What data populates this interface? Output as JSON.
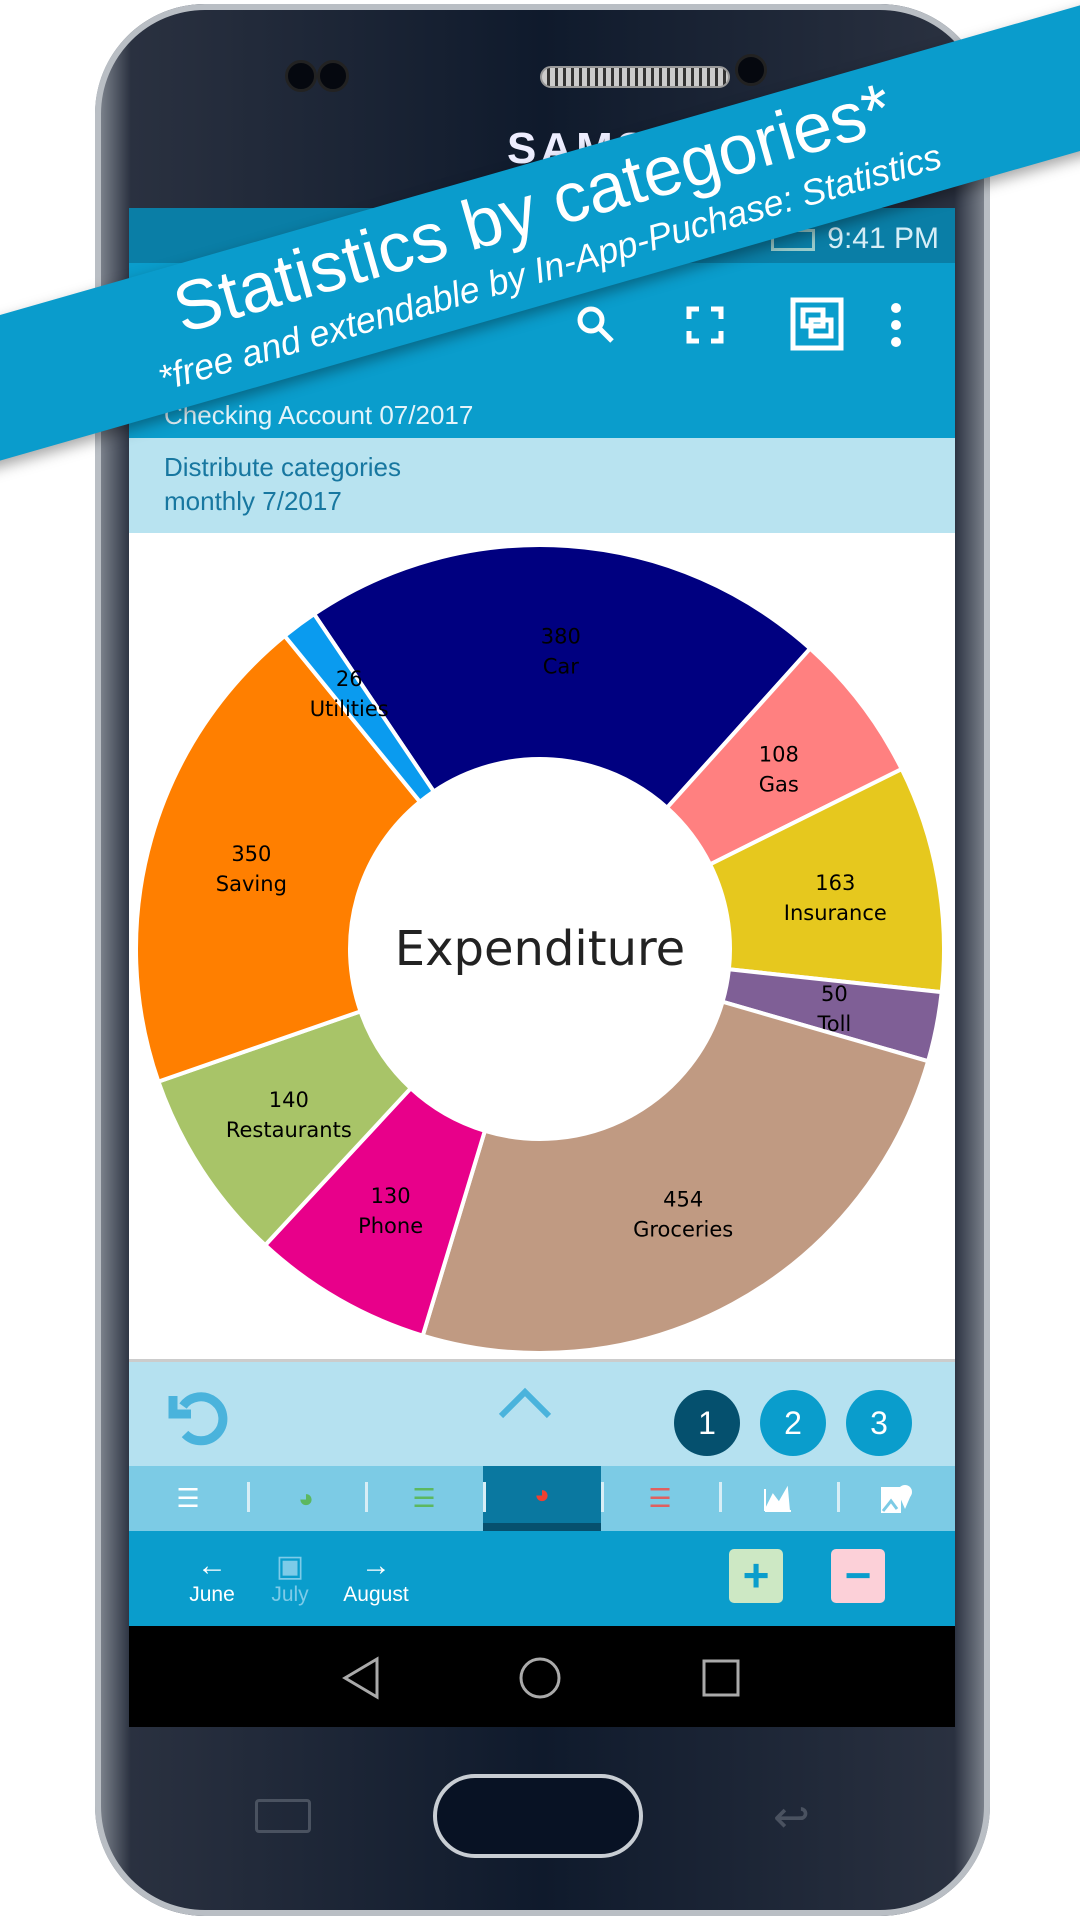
{
  "device": {
    "brand": "SAMSUNG"
  },
  "banner": {
    "title": "Statistics by categories*",
    "subtitle": "*free and extendable by In-App-Puchase: Statistics"
  },
  "status": {
    "time": "9:41 PM"
  },
  "toolbar": {
    "icons": [
      "search-icon",
      "fullscreen-icon",
      "window-icon",
      "more-icon"
    ],
    "account": "Checking Account 07/2017"
  },
  "header": {
    "line1": "Distribute categories",
    "line2": "monthly 7/2017"
  },
  "chart_data": {
    "type": "pie",
    "donut": true,
    "center_label": "Expenditure",
    "categories": [
      "Car",
      "Gas",
      "Insurance",
      "Toll",
      "Groceries",
      "Phone",
      "Restaurants",
      "Saving",
      "Utilities"
    ],
    "values": [
      380,
      108,
      163,
      50,
      454,
      130,
      140,
      350,
      26
    ],
    "colors": [
      "#000080",
      "#ff8080",
      "#e6c81e",
      "#7f5f96",
      "#c09a82",
      "#e8008a",
      "#a8c468",
      "#ff7f00",
      "#0a9bef"
    ]
  },
  "controls": {
    "pages": [
      "1",
      "2",
      "3"
    ],
    "active_page": "1"
  },
  "tabs": [
    {
      "icon": "numbered-list-icon"
    },
    {
      "icon": "pie-green-icon"
    },
    {
      "icon": "list-green-icon"
    },
    {
      "icon": "pie-red-icon",
      "active": true
    },
    {
      "icon": "list-red-icon"
    },
    {
      "icon": "line-chart-icon"
    },
    {
      "icon": "map-icon"
    }
  ],
  "bottom": {
    "prev": "June",
    "current": "July",
    "next": "August"
  }
}
